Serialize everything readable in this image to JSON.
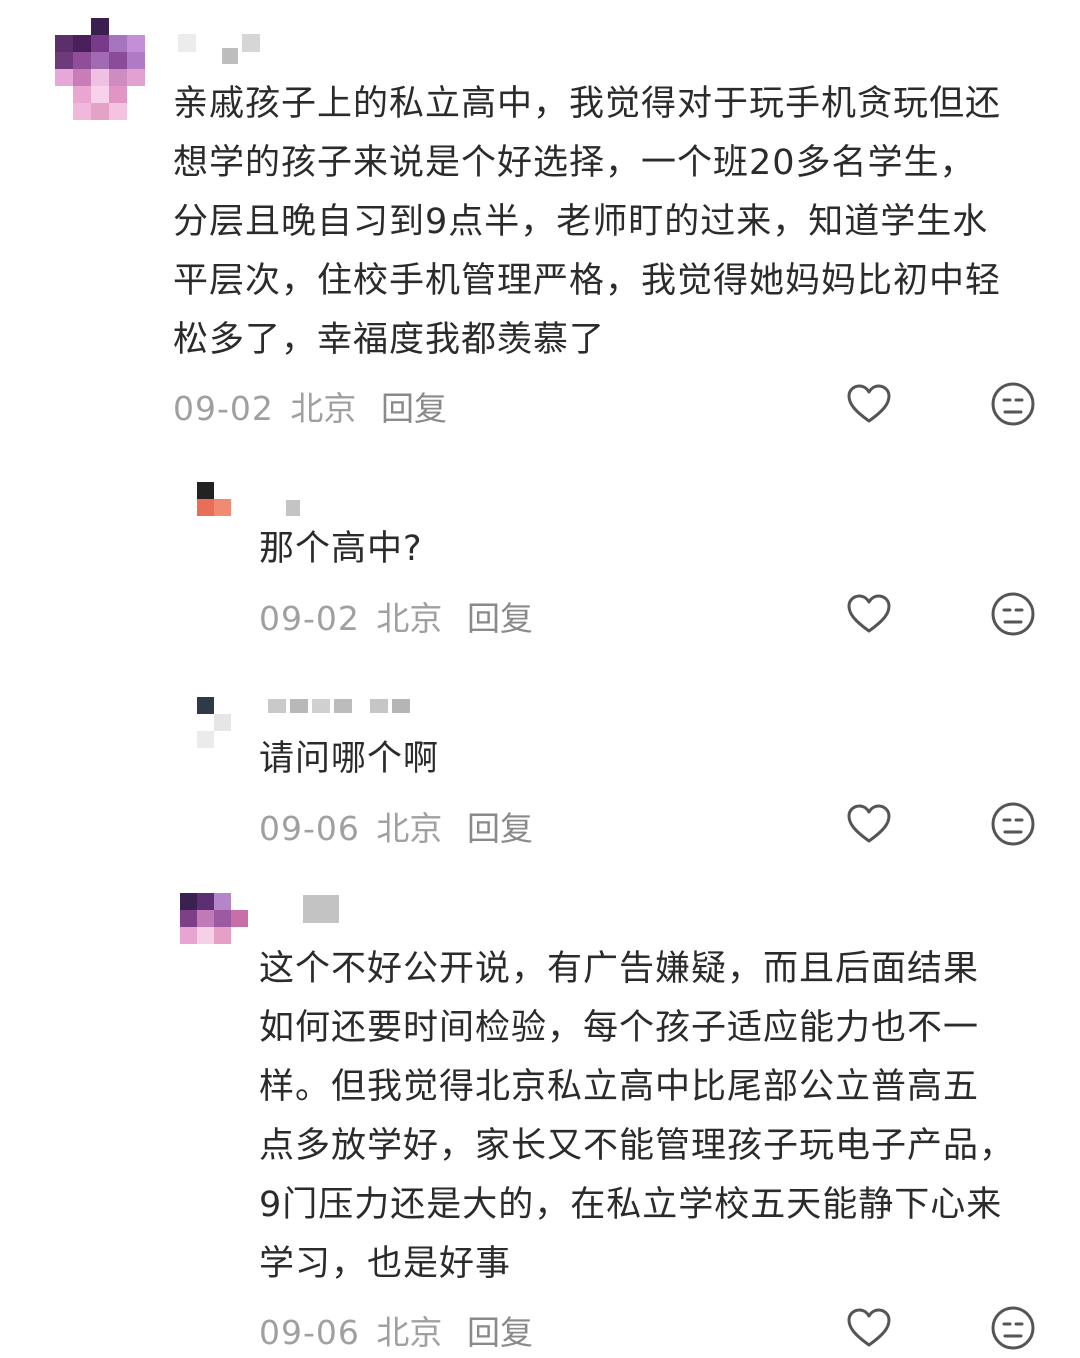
{
  "comments": [
    {
      "text": "亲戚孩子上的私立高中，我觉得对于玩手机贪玩但还\n想学的孩子来说是个好选择，一个班20多名学生，\n分层且晚自习到9点半，老师盯的过来，知道学生水\n平层次，住校手机管理严格，我觉得她妈妈比初中轻\n松多了，幸福度我都羡慕了",
      "time": "09-02",
      "location": "北京",
      "reply": "回复"
    },
    {
      "text": "那个高中?",
      "time": "09-02",
      "location": "北京",
      "reply": "回复"
    },
    {
      "text": "请问哪个啊",
      "time": "09-06",
      "location": "北京",
      "reply": "回复"
    },
    {
      "text": "这个不好公开说，有广告嫌疑，而且后面结果\n如何还要时间检验，每个孩子适应能力也不一\n样。但我觉得北京私立高中比尾部公立普高五\n点多放学好，家长又不能管理孩子玩电子产品，\n9门压力还是大的，在私立学校五天能静下心来\n学习，也是好事",
      "time": "09-06",
      "location": "北京",
      "reply": "回复"
    }
  ],
  "icons": {
    "like": "heart-icon",
    "dislike": "neutral-face-icon"
  },
  "colors": {
    "text": "#2b2b2b",
    "meta": "#a0a0a0",
    "icon": "#555555"
  }
}
